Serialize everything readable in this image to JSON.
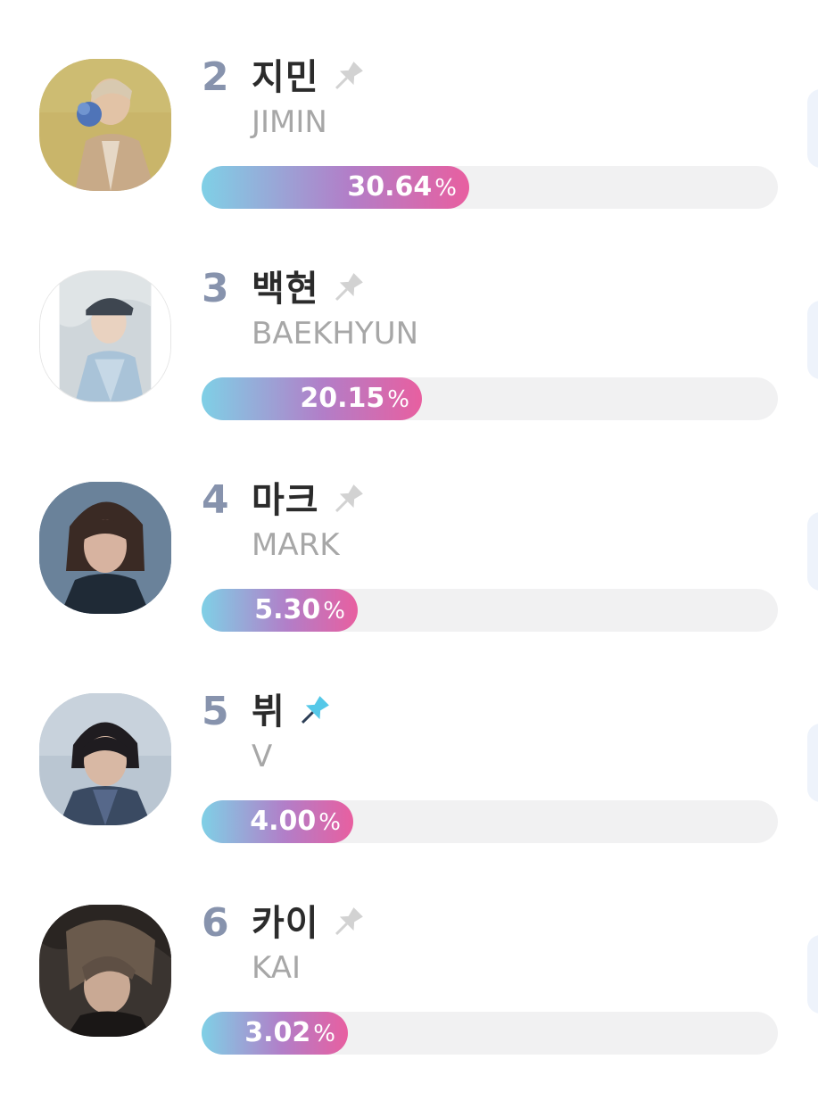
{
  "ranking": {
    "items": [
      {
        "rank": "2",
        "name_ko": "지민",
        "name_en": "JIMIN",
        "percent": "30.64",
        "percent_sign": "%",
        "share": 0.3064,
        "pinned": false,
        "avatar": "person-photo-jimin"
      },
      {
        "rank": "3",
        "name_ko": "백현",
        "name_en": "BAEKHYUN",
        "percent": "20.15",
        "percent_sign": "%",
        "share": 0.2015,
        "pinned": false,
        "avatar": "person-photo-baekhyun"
      },
      {
        "rank": "4",
        "name_ko": "마크",
        "name_en": "MARK",
        "percent": "5.30",
        "percent_sign": "%",
        "share": 0.053,
        "pinned": false,
        "avatar": "person-photo-mark"
      },
      {
        "rank": "5",
        "name_ko": "뷔",
        "name_en": "V",
        "percent": "4.00",
        "percent_sign": "%",
        "share": 0.04,
        "pinned": true,
        "avatar": "person-photo-v"
      },
      {
        "rank": "6",
        "name_ko": "카이",
        "name_en": "KAI",
        "percent": "3.02",
        "percent_sign": "%",
        "share": 0.0302,
        "pinned": false,
        "avatar": "person-photo-kai"
      }
    ]
  },
  "colors": {
    "rank": "#8793ad",
    "pin_inactive": "#d2d2d2",
    "pin_active": "#55c8e8",
    "bar_start": "#7fd0e6",
    "bar_end": "#e85fa0",
    "track": "#f1f1f2"
  },
  "icons": {
    "pin": "pushpin-icon"
  }
}
